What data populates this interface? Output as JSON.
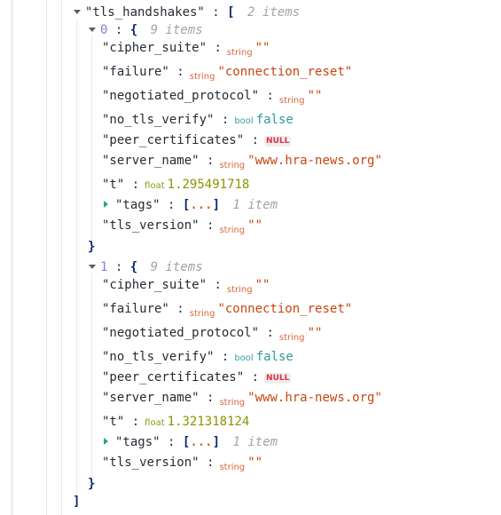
{
  "root": {
    "key": "\"tls_handshakes\"",
    "open": "[",
    "close": "]",
    "count": "2 items",
    "items": [
      {
        "index": "0",
        "open": "{",
        "close": "}",
        "count": "9 items",
        "fields": {
          "cipher_suite": {
            "key": "\"cipher_suite\"",
            "type": "string",
            "value": "\"\""
          },
          "failure": {
            "key": "\"failure\"",
            "type": "string",
            "value": "\"connection_reset\""
          },
          "negotiated_protocol": {
            "key": "\"negotiated_protocol\"",
            "type": "string",
            "value": "\"\""
          },
          "no_tls_verify": {
            "key": "\"no_tls_verify\"",
            "type": "bool",
            "value": "false"
          },
          "peer_certificates": {
            "key": "\"peer_certificates\"",
            "value": "NULL"
          },
          "server_name": {
            "key": "\"server_name\"",
            "type": "string",
            "value": "\"www.hra-news.org\""
          },
          "t": {
            "key": "\"t\"",
            "type": "float",
            "value": "1.295491718"
          },
          "tags": {
            "key": "\"tags\"",
            "open": "[",
            "ellipsis": "...",
            "close": "]",
            "count": "1 item"
          },
          "tls_version": {
            "key": "\"tls_version\"",
            "type": "string",
            "value": "\"\""
          }
        }
      },
      {
        "index": "1",
        "open": "{",
        "close": "}",
        "count": "9 items",
        "fields": {
          "cipher_suite": {
            "key": "\"cipher_suite\"",
            "type": "string",
            "value": "\"\""
          },
          "failure": {
            "key": "\"failure\"",
            "type": "string",
            "value": "\"connection_reset\""
          },
          "negotiated_protocol": {
            "key": "\"negotiated_protocol\"",
            "type": "string",
            "value": "\"\""
          },
          "no_tls_verify": {
            "key": "\"no_tls_verify\"",
            "type": "bool",
            "value": "false"
          },
          "peer_certificates": {
            "key": "\"peer_certificates\"",
            "value": "NULL"
          },
          "server_name": {
            "key": "\"server_name\"",
            "type": "string",
            "value": "\"www.hra-news.org\""
          },
          "t": {
            "key": "\"t\"",
            "type": "float",
            "value": "1.321318124"
          },
          "tags": {
            "key": "\"tags\"",
            "open": "[",
            "ellipsis": "...",
            "close": "]",
            "count": "1 item"
          },
          "tls_version": {
            "key": "\"tls_version\"",
            "type": "string",
            "value": "\"\""
          }
        }
      }
    ]
  },
  "colon": ":",
  "icons": {
    "expanded": "caret-down-icon",
    "collapsed": "caret-right-icon"
  }
}
